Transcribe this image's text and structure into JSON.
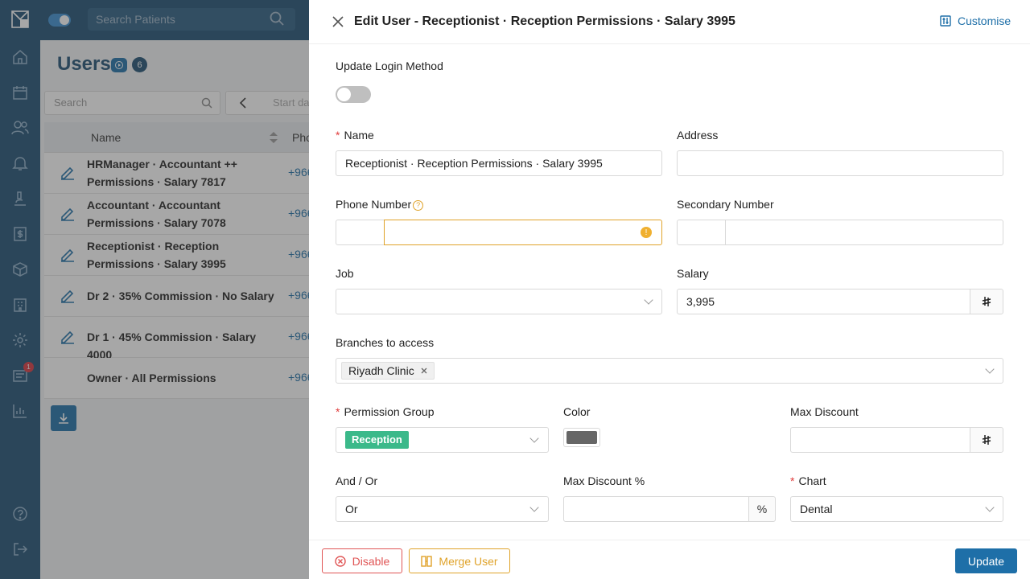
{
  "topbar": {
    "search_placeholder": "Search Patients"
  },
  "page": {
    "title": "Users",
    "count": "6",
    "search_placeholder": "Search",
    "date_placeholder": "Start da",
    "columns": [
      "Name",
      "Pho"
    ],
    "rows": [
      {
        "name": "HRManager · Accountant ++ Permissions · Salary 7817",
        "phone": "+966",
        "editable": true
      },
      {
        "name": "Accountant · Accountant Permissions · Salary 7078",
        "phone": "+966",
        "editable": true
      },
      {
        "name": "Receptionist · Reception Permissions · Salary 3995",
        "phone": "+966",
        "editable": true
      },
      {
        "name": "Dr 2 · 35% Commission · No Salary",
        "phone": "+966",
        "editable": true
      },
      {
        "name": "Dr 1 · 45% Commission · Salary 4000",
        "phone": "+966",
        "editable": true
      },
      {
        "name": "Owner · All Permissions",
        "phone": "+966",
        "editable": false
      }
    ]
  },
  "nav": {
    "notification_count": "1"
  },
  "drawer": {
    "title": "Edit User - Receptionist · Reception Permissions · Salary 3995",
    "customise_label": "Customise",
    "login_method_label": "Update Login Method",
    "login_method_enabled": false,
    "name_label": "Name",
    "name_value": "Receptionist · Reception Permissions · Salary 3995",
    "address_label": "Address",
    "address_value": "",
    "phone_label": "Phone Number",
    "phone_value": "",
    "secondary_label": "Secondary Number",
    "secondary_value": "",
    "job_label": "Job",
    "job_value": "",
    "salary_label": "Salary",
    "salary_value": "3,995",
    "currency_symbol": "⃁",
    "branches_label": "Branches to access",
    "branches": [
      "Riyadh Clinic"
    ],
    "permission_label": "Permission Group",
    "permission_value": "Reception",
    "color_label": "Color",
    "color_value": "#666666",
    "max_discount_label": "Max Discount",
    "max_discount_value": "",
    "andor_label": "And / Or",
    "andor_value": "Or",
    "max_discount_pct_label": "Max Discount %",
    "max_discount_pct_value": "",
    "percent_symbol": "%",
    "chart_label": "Chart",
    "chart_value": "Dental",
    "required_mark": "*"
  },
  "footer": {
    "disable_label": "Disable",
    "merge_label": "Merge User",
    "update_label": "Update"
  },
  "colors": {
    "brand": "#1e4f73",
    "accent": "#1e6fa8",
    "danger": "#e05555",
    "warning": "#e0a32a",
    "tag": "#3bb98a"
  }
}
